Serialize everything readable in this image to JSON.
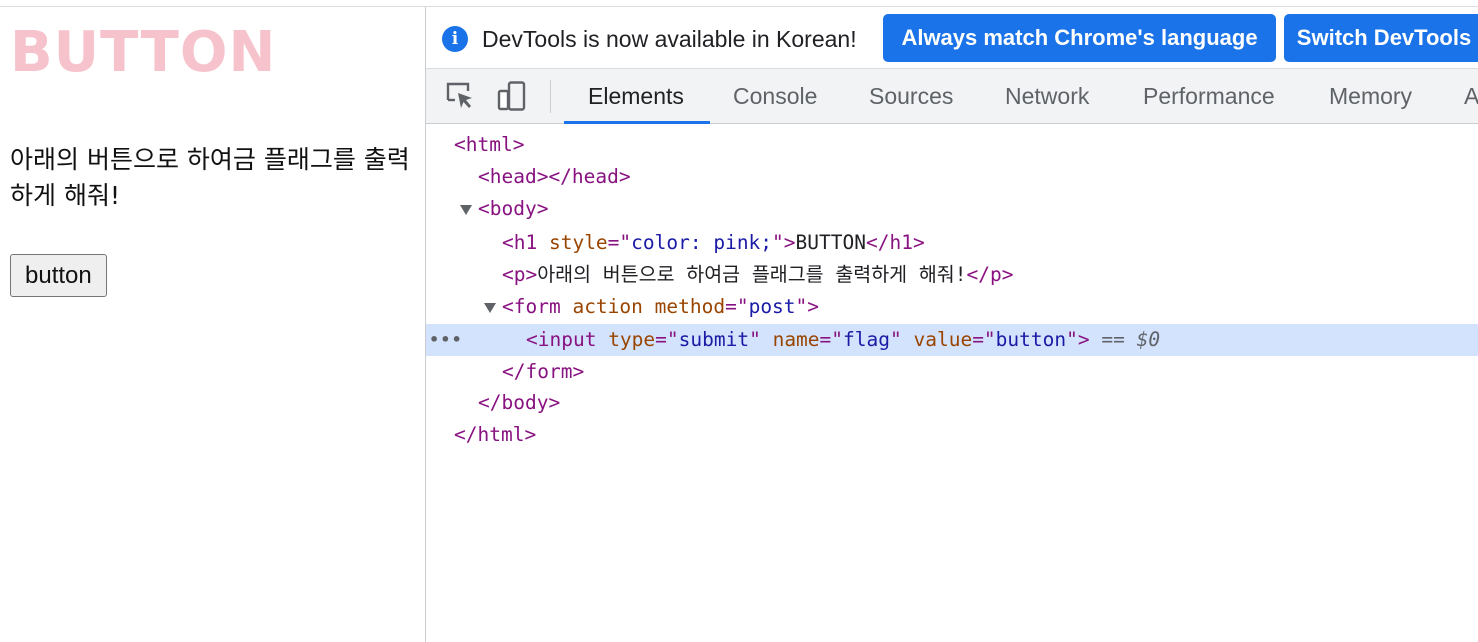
{
  "page": {
    "title": "BUTTON",
    "title_color": "pink",
    "paragraph": "아래의 버튼으로 하여금 플래그를 출력하게 해줘!",
    "button_label": "button"
  },
  "infobar": {
    "icon_text": "i",
    "message": "DevTools is now available in Korean!",
    "btn_match": "Always match Chrome's language",
    "btn_switch": "Switch DevTools"
  },
  "toolbar": {
    "tabs": [
      "Elements",
      "Console",
      "Sources",
      "Network",
      "Performance",
      "Memory",
      "A"
    ],
    "active_tab": "Elements"
  },
  "dom": {
    "html_open": "<html>",
    "head": "<head></head>",
    "body_open": "<body>",
    "h1_open_a": "<h1 ",
    "h1_attr_style": "style",
    "h1_eq": "=\"",
    "h1_style_val": "color: pink;",
    "h1_close_q": "\">",
    "h1_text": "BUTTON",
    "h1_close": "</h1>",
    "p_open": "<p>",
    "p_text": "아래의 버튼으로 하여금 플래그를 출력하게 해줘!",
    "p_close": "</p>",
    "form_open_a": "<form ",
    "form_attr_action": "action",
    "form_attr_method": " method",
    "form_eq": "=\"",
    "form_method_val": "post",
    "form_close_q": "\">",
    "input_open": "<input ",
    "input_attr_type": "type",
    "input_eq1": "=\"",
    "input_type_val": "submit",
    "input_q1": "\" ",
    "input_attr_name": "name",
    "input_eq2": "=\"",
    "input_name_val": "flag",
    "input_q2": "\" ",
    "input_attr_value": "value",
    "input_eq3": "=\"",
    "input_value_val": "button",
    "input_close": "\">",
    "selected_marker_eq": " == ",
    "selected_marker_var": "$0",
    "ellipsis": "•••",
    "form_close": "</form>",
    "body_close": "</body>",
    "html_close": "</html>"
  },
  "colors": {
    "accent_blue": "#1a73e8",
    "selected_row": "#d3e3fd",
    "tag": "#881280",
    "attr": "#994500",
    "value": "#1a1aa6",
    "title_pink": "#f6c2cb"
  },
  "icons": {
    "inspect": "inspect-element-icon",
    "device": "device-toolbar-icon",
    "info": "info-icon",
    "expand": "triangle-down-icon"
  }
}
